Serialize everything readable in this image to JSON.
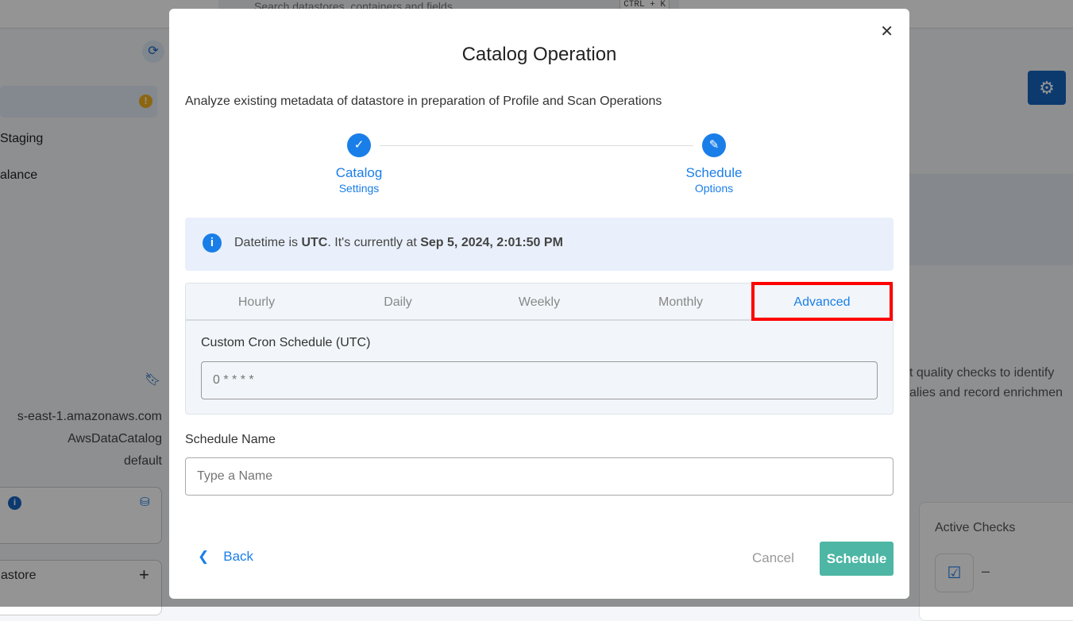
{
  "background": {
    "search_placeholder": "Search datastores, containers and fields",
    "shortcut": "CTRL + K",
    "sidebar_items": [
      "Staging",
      "alance"
    ],
    "details": [
      "s-east-1.amazonaws.com",
      "AwsDataCatalog",
      "default"
    ],
    "add_datastore": "astore",
    "right_text": [
      "t quality checks to identify",
      "alies and record enrichmen"
    ],
    "active_checks_label": "Active Checks",
    "active_checks_value": "–"
  },
  "modal": {
    "title": "Catalog Operation",
    "description": "Analyze existing metadata of datastore in preparation of Profile and Scan Operations",
    "steps": [
      {
        "title": "Catalog",
        "subtitle": "Settings",
        "state": "completed"
      },
      {
        "title": "Schedule",
        "subtitle": "Options",
        "state": "editing"
      }
    ],
    "info": {
      "prefix": "Datetime is ",
      "tz": "UTC",
      "middle": ". It's currently at ",
      "datetime": "Sep 5, 2024, 2:01:50 PM"
    },
    "tabs": [
      "Hourly",
      "Daily",
      "Weekly",
      "Monthly",
      "Advanced"
    ],
    "active_tab": "Advanced",
    "cron_label": "Custom Cron Schedule (UTC)",
    "cron_placeholder": "0 * * * *",
    "name_label": "Schedule Name",
    "name_placeholder": "Type a Name",
    "back_label": "Back",
    "cancel_label": "Cancel",
    "schedule_label": "Schedule"
  },
  "colors": {
    "accent": "#1a7ee8",
    "schedule_button": "#4db6a4",
    "highlight": "#ff0000"
  }
}
